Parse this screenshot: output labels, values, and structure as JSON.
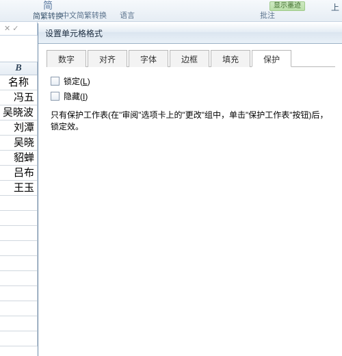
{
  "ribbon": {
    "item1_label": "简繁转换",
    "item1_icon": "简",
    "group_a": "中文简繁转换",
    "group_b": "语言",
    "group_c": "批注",
    "green_label": "显示墨迹",
    "right_stub": "上"
  },
  "formula_bar": {
    "fx": "✕ ✓"
  },
  "sheet": {
    "col_header": "B",
    "rows": [
      "名称",
      "冯五",
      "吴晓波",
      "刘潭",
      "吴晓",
      "貂蝉",
      "吕布",
      "王玉"
    ]
  },
  "dialog": {
    "title": "设置单元格格式",
    "tabs": [
      "数字",
      "对齐",
      "字体",
      "边框",
      "填充",
      "保护"
    ],
    "active_tab_index": 5,
    "protect": {
      "lock_label": "锁定(L)",
      "lock_hotkey": "L",
      "hide_label": "隐藏(I)",
      "hide_hotkey": "I",
      "lock_checked": false,
      "hide_checked": false,
      "desc": "只有保护工作表(在\"审阅\"选项卡上的\"更改\"组中，单击\"保护工作表\"按钮)后，锁定效。"
    }
  }
}
